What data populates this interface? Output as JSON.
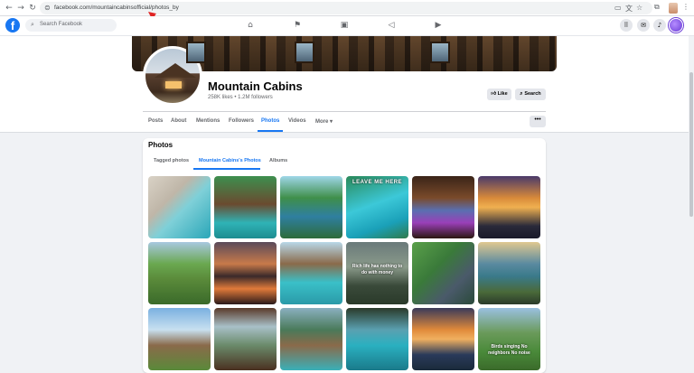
{
  "browser": {
    "url": "facebook.com/mountaincabinsofficial/photos_by",
    "icons": [
      "back-icon",
      "forward-icon",
      "reload-icon",
      "site-info-icon",
      "cast-icon",
      "translate-icon",
      "bookmark-star-icon",
      "extensions-icon",
      "sidebar-icon"
    ]
  },
  "fb_nav": {
    "logo": "f",
    "search_placeholder": "Search Facebook",
    "center_icons": [
      "home-icon",
      "pages-flag-icon",
      "marketplace-icon",
      "ads-megaphone-icon",
      "video-icon"
    ],
    "right_icons": [
      "menu-grid-icon",
      "messenger-icon",
      "notifications-bell-icon",
      "account-avatar"
    ]
  },
  "profile": {
    "name": "Mountain Cabins",
    "stats": "258K likes • 1.2M followers",
    "like_label": "Like",
    "search_label": "Search",
    "tabs": [
      {
        "label": "Posts"
      },
      {
        "label": "About"
      },
      {
        "label": "Mentions"
      },
      {
        "label": "Followers"
      },
      {
        "label": "Photos"
      },
      {
        "label": "Videos"
      },
      {
        "label": "More ▾"
      }
    ],
    "active_tab": "Photos",
    "more_label": "•••"
  },
  "photos": {
    "title": "Photos",
    "subtabs": [
      {
        "label": "Tagged photos"
      },
      {
        "label": "Mountain Cabins's Photos"
      },
      {
        "label": "Albums"
      }
    ],
    "active_subtab": "Mountain Cabins's Photos",
    "captions": {
      "leave_me_here": "LEAVE ME HERE",
      "rich_life": "Rich life has nothing to do with money",
      "birds_singing": "Birds singing No neighbors No noise"
    }
  },
  "colors": {
    "brand_blue": "#1877f2",
    "background": "#f0f2f5",
    "secondary_text": "#65676b"
  }
}
